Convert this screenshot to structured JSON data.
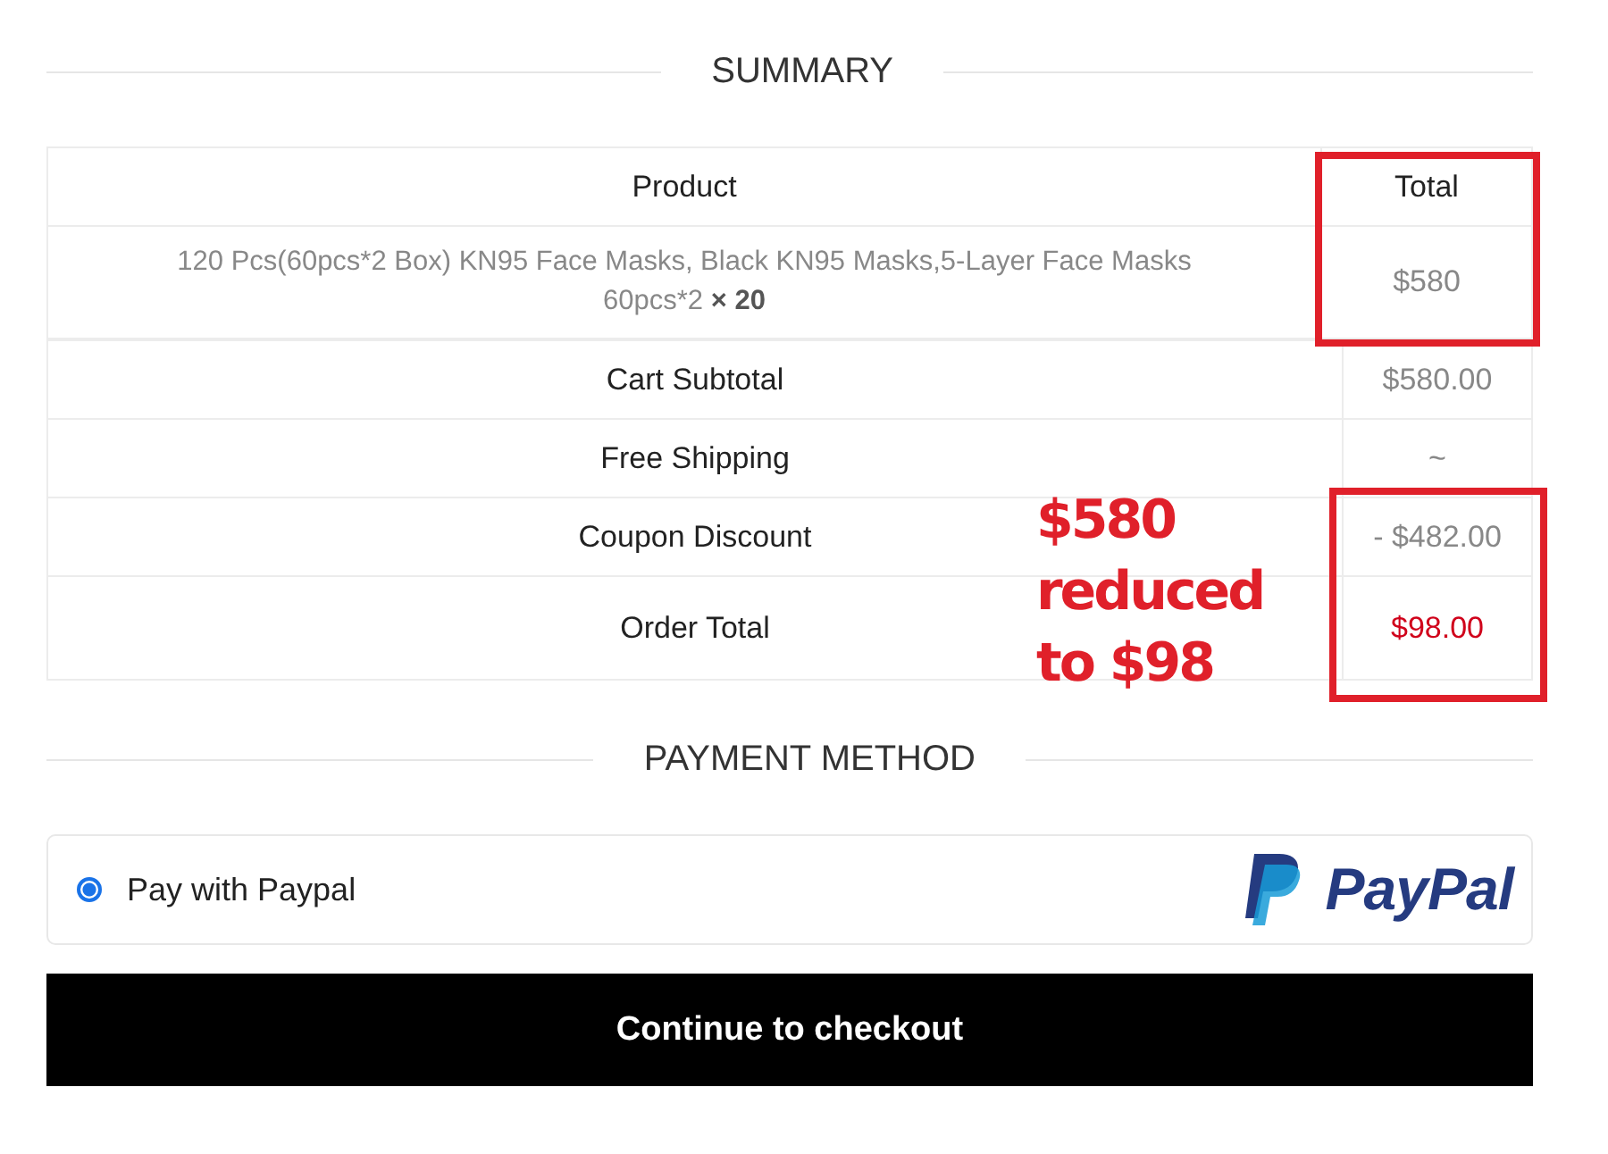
{
  "summary": {
    "heading": "SUMMARY",
    "columns": [
      {
        "label": "Product",
        "highlighted": false
      },
      {
        "label": "Total",
        "highlighted": true
      }
    ],
    "items": [
      {
        "product": "120 Pcs(60pcs*2 Box) KN95 Face Masks, Black KN95 Masks,5-Layer Face Masks 60pcs*2 **× 20**",
        "total": "$580"
      }
    ],
    "totals": [
      {
        "label": "Cart Subtotal",
        "value": "$580.00",
        "kind": "plain",
        "highlighted": false
      },
      {
        "label": "Free Shipping",
        "value": "~",
        "kind": "plain",
        "highlighted": false
      },
      {
        "label": "Coupon Discount",
        "value": "- $482.00",
        "kind": "plain",
        "highlighted": true
      },
      {
        "label": "Order Total",
        "value": "$98.00",
        "kind": "grand",
        "highlighted": true
      }
    ]
  },
  "annotation": {
    "lines": [
      "$580",
      "reduced",
      "to $98"
    ]
  },
  "payment": {
    "heading": "PAYMENT METHOD",
    "options": [
      {
        "label": "Pay with Paypal",
        "selected": true,
        "logo_text": "PayPal"
      }
    ]
  },
  "checkout_button": "Continue to checkout"
}
